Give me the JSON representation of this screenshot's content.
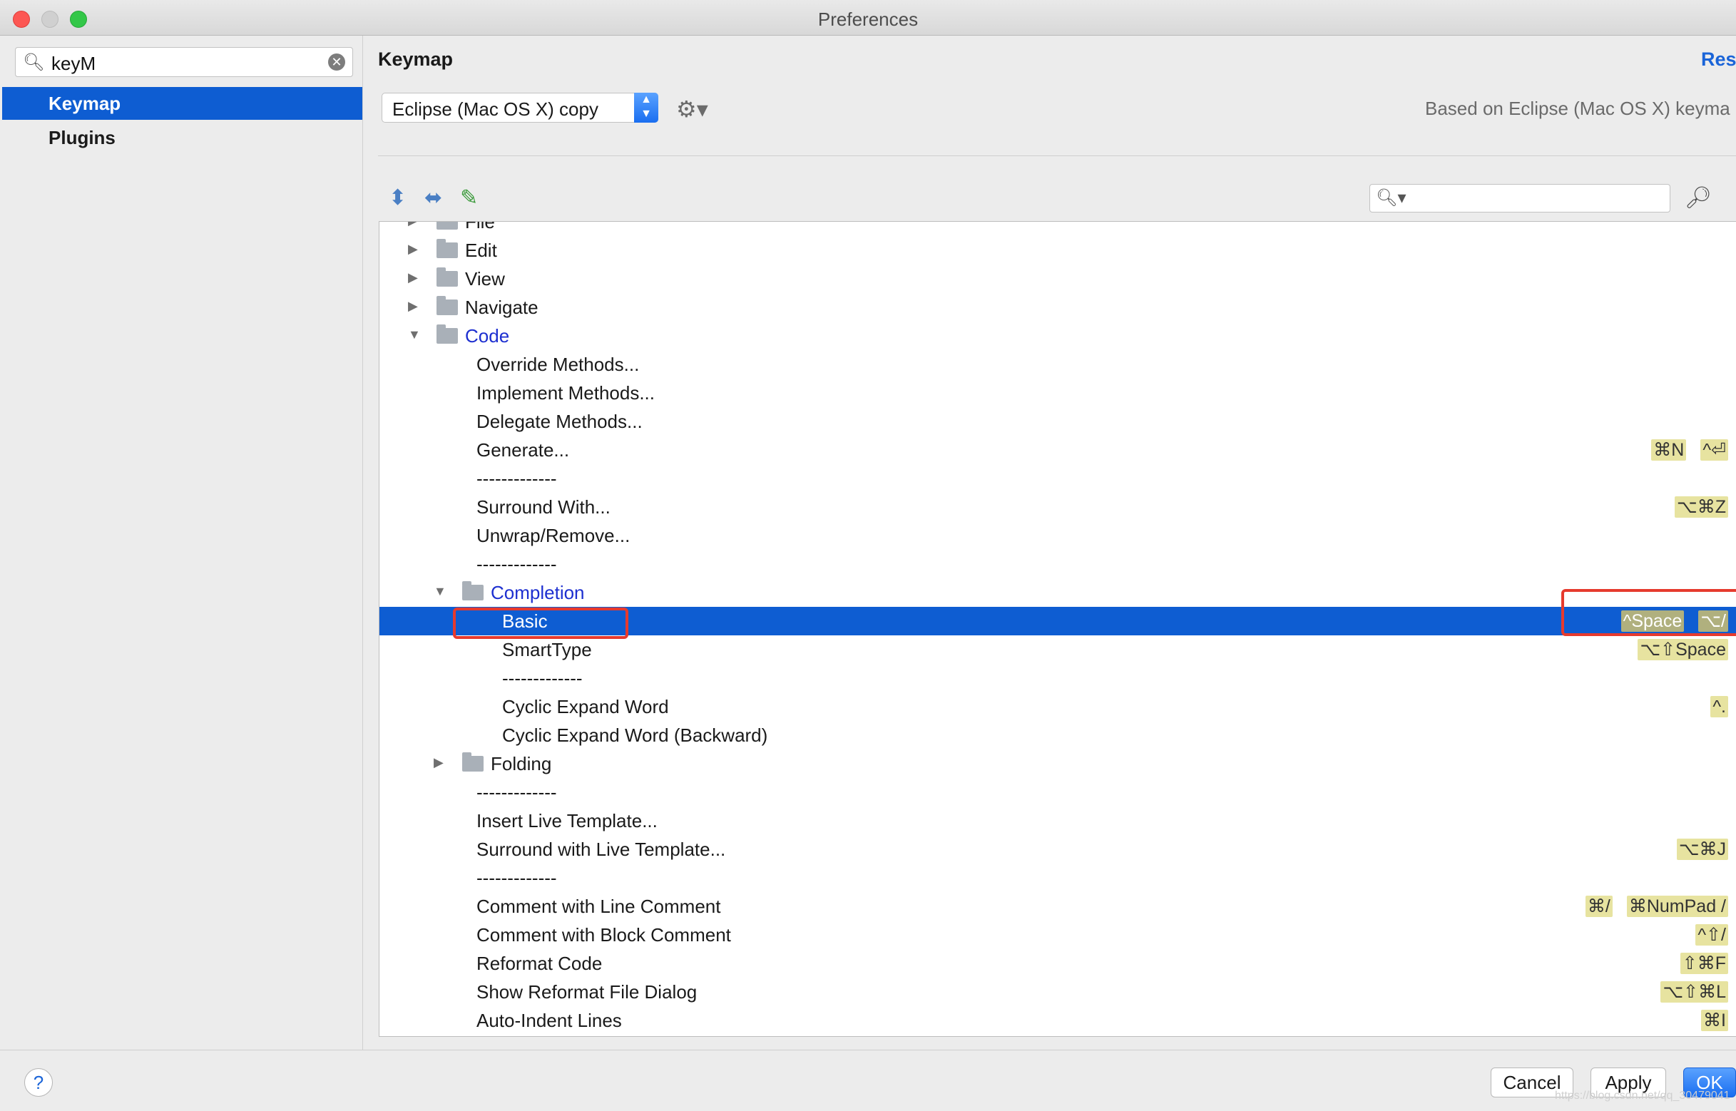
{
  "window": {
    "title": "Preferences"
  },
  "sidebar": {
    "search_value": "keyM",
    "items": [
      {
        "label": "Keymap",
        "selected": true
      },
      {
        "label": "Plugins",
        "selected": false
      }
    ]
  },
  "main": {
    "title": "Keymap",
    "reset_label": "Res",
    "keymap_selected": "Eclipse (Mac OS X) copy",
    "based_on": "Based on Eclipse (Mac OS X) keyma",
    "filter_placeholder": ""
  },
  "tree": {
    "rows": [
      {
        "level": 0,
        "kind": "folder",
        "expanded": false,
        "label": "File",
        "shortcuts": []
      },
      {
        "level": 0,
        "kind": "folder",
        "expanded": false,
        "label": "Edit",
        "shortcuts": []
      },
      {
        "level": 0,
        "kind": "folder",
        "expanded": false,
        "label": "View",
        "shortcuts": []
      },
      {
        "level": 0,
        "kind": "folder",
        "expanded": false,
        "label": "Navigate",
        "shortcuts": []
      },
      {
        "level": 0,
        "kind": "folder",
        "expanded": true,
        "label": "Code",
        "group": true,
        "shortcuts": []
      },
      {
        "level": 1,
        "kind": "action",
        "label": "Override Methods...",
        "shortcuts": []
      },
      {
        "level": 1,
        "kind": "action",
        "label": "Implement Methods...",
        "shortcuts": []
      },
      {
        "level": 1,
        "kind": "action",
        "label": "Delegate Methods...",
        "shortcuts": []
      },
      {
        "level": 1,
        "kind": "action",
        "label": "Generate...",
        "shortcuts": [
          "⌘N",
          "^⏎"
        ]
      },
      {
        "level": 1,
        "kind": "separator",
        "label": "-------------",
        "shortcuts": []
      },
      {
        "level": 1,
        "kind": "action",
        "label": "Surround With...",
        "shortcuts": [
          "⌥⌘Z"
        ]
      },
      {
        "level": 1,
        "kind": "action",
        "label": "Unwrap/Remove...",
        "shortcuts": []
      },
      {
        "level": 1,
        "kind": "separator",
        "label": "-------------",
        "shortcuts": []
      },
      {
        "level": 1,
        "kind": "folder",
        "expanded": true,
        "label": "Completion",
        "group": true,
        "shortcuts": []
      },
      {
        "level": 2,
        "kind": "action",
        "label": "Basic",
        "selected": true,
        "shortcuts": [
          "^Space",
          "⌥/"
        ]
      },
      {
        "level": 2,
        "kind": "action",
        "label": "SmartType",
        "shortcuts": [
          "⌥⇧Space"
        ]
      },
      {
        "level": 2,
        "kind": "separator",
        "label": "-------------",
        "shortcuts": []
      },
      {
        "level": 2,
        "kind": "action",
        "label": "Cyclic Expand Word",
        "shortcuts": [
          "^."
        ]
      },
      {
        "level": 2,
        "kind": "action",
        "label": "Cyclic Expand Word (Backward)",
        "shortcuts": []
      },
      {
        "level": 1,
        "kind": "folder",
        "expanded": false,
        "label": "Folding",
        "shortcuts": []
      },
      {
        "level": 1,
        "kind": "separator",
        "label": "-------------",
        "shortcuts": []
      },
      {
        "level": 1,
        "kind": "action",
        "label": "Insert Live Template...",
        "shortcuts": []
      },
      {
        "level": 1,
        "kind": "action",
        "label": "Surround with Live Template...",
        "shortcuts": [
          "⌥⌘J"
        ]
      },
      {
        "level": 1,
        "kind": "separator",
        "label": "-------------",
        "shortcuts": []
      },
      {
        "level": 1,
        "kind": "action",
        "label": "Comment with Line Comment",
        "shortcuts": [
          "⌘/",
          "⌘NumPad /"
        ]
      },
      {
        "level": 1,
        "kind": "action",
        "label": "Comment with Block Comment",
        "shortcuts": [
          "^⇧/"
        ]
      },
      {
        "level": 1,
        "kind": "action",
        "label": "Reformat Code",
        "shortcuts": [
          "⇧⌘F"
        ]
      },
      {
        "level": 1,
        "kind": "action",
        "label": "Show Reformat File Dialog",
        "shortcuts": [
          "⌥⇧⌘L"
        ]
      },
      {
        "level": 1,
        "kind": "action",
        "label": "Auto-Indent Lines",
        "shortcuts": [
          "⌘I"
        ]
      }
    ]
  },
  "buttons": {
    "help": "?",
    "cancel": "Cancel",
    "apply": "Apply",
    "ok": "OK"
  },
  "watermark": "https://blog.csdn.net/qq_30479041",
  "colors": {
    "selection": "#0e5dd2",
    "group_text": "#1d2fd0",
    "shortcut_bg": "#e7e3a0",
    "highlight_box": "#e63a2e"
  }
}
